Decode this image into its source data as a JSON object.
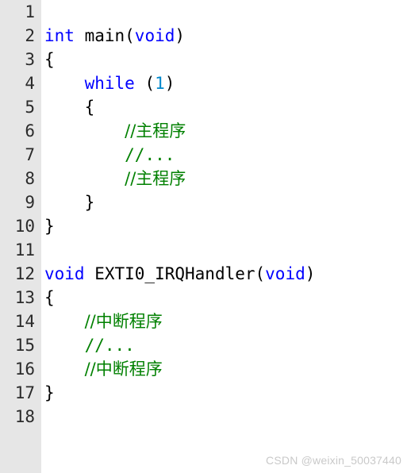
{
  "editor": {
    "gutter_color": "#e6e6e6",
    "background_color": "#ffffff",
    "keyword_color": "#0000ff",
    "comment_color": "#008000",
    "number_color": "#0088cc",
    "text_color": "#000000",
    "total_lines": 18,
    "language": "c"
  },
  "lines": [
    {
      "n": "1",
      "indent": "",
      "tokens": []
    },
    {
      "n": "2",
      "indent": "",
      "tokens": [
        {
          "t": "int",
          "c": "kw"
        },
        {
          "t": " main(",
          "c": "plain"
        },
        {
          "t": "void",
          "c": "kw"
        },
        {
          "t": ")",
          "c": "plain"
        }
      ]
    },
    {
      "n": "3",
      "indent": "",
      "tokens": [
        {
          "t": "{",
          "c": "plain"
        }
      ]
    },
    {
      "n": "4",
      "indent": "    ",
      "tokens": [
        {
          "t": "while",
          "c": "kw"
        },
        {
          "t": " (",
          "c": "plain"
        },
        {
          "t": "1",
          "c": "num"
        },
        {
          "t": ")",
          "c": "plain"
        }
      ]
    },
    {
      "n": "5",
      "indent": "    ",
      "tokens": [
        {
          "t": "{",
          "c": "plain"
        }
      ]
    },
    {
      "n": "6",
      "indent": "        ",
      "tokens": [
        {
          "t": "//主程序",
          "c": "comment"
        }
      ]
    },
    {
      "n": "7",
      "indent": "        ",
      "tokens": [
        {
          "t": "//...",
          "c": "comment"
        }
      ]
    },
    {
      "n": "8",
      "indent": "        ",
      "tokens": [
        {
          "t": "//主程序",
          "c": "comment"
        }
      ]
    },
    {
      "n": "9",
      "indent": "    ",
      "tokens": [
        {
          "t": "}",
          "c": "plain"
        }
      ]
    },
    {
      "n": "10",
      "indent": "",
      "tokens": [
        {
          "t": "}",
          "c": "plain"
        }
      ]
    },
    {
      "n": "11",
      "indent": "",
      "tokens": []
    },
    {
      "n": "12",
      "indent": "",
      "tokens": [
        {
          "t": "void",
          "c": "kw"
        },
        {
          "t": " EXTI0_IRQHandler(",
          "c": "plain"
        },
        {
          "t": "void",
          "c": "kw"
        },
        {
          "t": ")",
          "c": "plain"
        }
      ]
    },
    {
      "n": "13",
      "indent": "",
      "tokens": [
        {
          "t": "{",
          "c": "plain"
        }
      ]
    },
    {
      "n": "14",
      "indent": "    ",
      "tokens": [
        {
          "t": "//中断程序",
          "c": "comment"
        }
      ]
    },
    {
      "n": "15",
      "indent": "    ",
      "tokens": [
        {
          "t": "//...",
          "c": "comment"
        }
      ]
    },
    {
      "n": "16",
      "indent": "    ",
      "tokens": [
        {
          "t": "//中断程序",
          "c": "comment"
        }
      ]
    },
    {
      "n": "17",
      "indent": "",
      "tokens": [
        {
          "t": "}",
          "c": "plain"
        }
      ]
    },
    {
      "n": "18",
      "indent": "",
      "tokens": []
    }
  ],
  "watermark": {
    "text": "CSDN @weixin_50037440"
  }
}
